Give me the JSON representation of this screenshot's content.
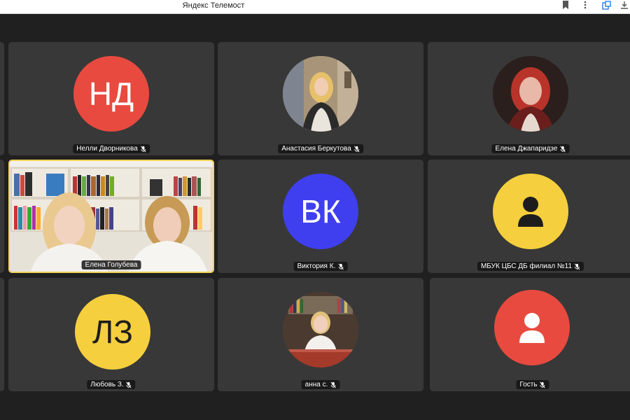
{
  "window": {
    "title": "Яндекс Телемост",
    "icons": [
      "bookmark-icon",
      "more-vert-icon",
      "extensions-icon",
      "download-icon"
    ]
  },
  "participants": [
    {
      "name": "Нелли Дворникова",
      "initials": "НД",
      "avatar_color": "#e84a3f",
      "muted": true
    },
    {
      "name": "Анастасия Беркутова",
      "photo": true,
      "muted": true
    },
    {
      "name": "Елена Джапаридзе",
      "photo": true,
      "muted": true
    },
    {
      "name": "Елена Голубева",
      "video": true,
      "active_speaker": true,
      "muted": false
    },
    {
      "name": "Виктория К.",
      "initials": "ВК",
      "avatar_color": "#3f3ff0",
      "muted": true
    },
    {
      "name": "МБУК ЦБС ДБ филиал №11",
      "avatar_color": "#f5cf3d",
      "icon": "person-icon",
      "muted": true
    },
    {
      "name": "Любовь З.",
      "initials": "ЛЗ",
      "avatar_color": "#f5cf3d",
      "muted": true
    },
    {
      "name": "анна с.",
      "photo": true,
      "muted": true
    },
    {
      "name": "Гость",
      "avatar_color": "#e84a3f",
      "icon": "person-icon",
      "muted": true
    }
  ],
  "colors": {
    "background": "#202020",
    "tile": "#383838",
    "active_border": "#f0d454"
  }
}
